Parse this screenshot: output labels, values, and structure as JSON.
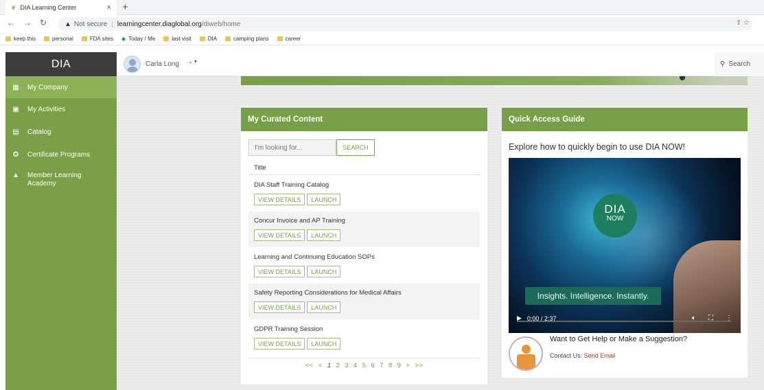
{
  "browser": {
    "tab_title": "DIA Learning Center",
    "tab_close": "×",
    "new_tab": "+",
    "security_label": "Not secure",
    "url_host": "learningcenter.diaglobal.org",
    "url_path": "/diweb/home",
    "bookmarks": [
      "keep this",
      "personal",
      "FDA sites",
      "Today / Me",
      "last visit",
      "DIA",
      "camping plans",
      "career"
    ]
  },
  "sidebar": {
    "brand": "DIA",
    "items": [
      {
        "label": "My Company",
        "icon": "building-icon"
      },
      {
        "label": "My Activities",
        "icon": "calendar-check-icon"
      },
      {
        "label": "Catalog",
        "icon": "list-icon"
      },
      {
        "label": "Certificate Programs",
        "icon": "award-icon"
      },
      {
        "label": "Member Learning Academy",
        "icon": "graduation-cap-icon"
      }
    ]
  },
  "topbar": {
    "user_name": "Carla Long",
    "search_label": "Search"
  },
  "curated": {
    "title": "My Curated Content",
    "search_placeholder": "I'm looking for...",
    "search_button": "SEARCH",
    "column_title": "Title",
    "view_label": "VIEW DETAILS",
    "launch_label": "LAUNCH",
    "courses": [
      "DIA Staff Training Catalog",
      "Concur Invoice and AP Training",
      "Learning and Continuing Education SOPs",
      "Safety Reporting Considerations for Medical Affairs",
      "GDPR Training Session"
    ],
    "pager": [
      "<<",
      "<",
      "1",
      "2",
      "3",
      "4",
      "5",
      "6",
      "7",
      "8",
      "9",
      ">",
      ">>"
    ]
  },
  "quick": {
    "title": "Quick Access Guide",
    "subtitle": "Explore how to quickly begin to use DIA NOW!",
    "video_badge_top": "DIA",
    "video_badge_bottom": "NOW",
    "video_caption": "Insights. Intelligence. Instantly.",
    "video_time": "0:00 / 2:37",
    "help_title": "Want to Get Help or Make a Suggestion?",
    "contact_prefix": "Contact Us:",
    "contact_link": "Send Email"
  },
  "colors": {
    "brand_green": "#76a045",
    "sidebar_green": "#7a9f47",
    "sidebar_active": "#8cb255",
    "brand_dark": "#3d3d3d"
  }
}
